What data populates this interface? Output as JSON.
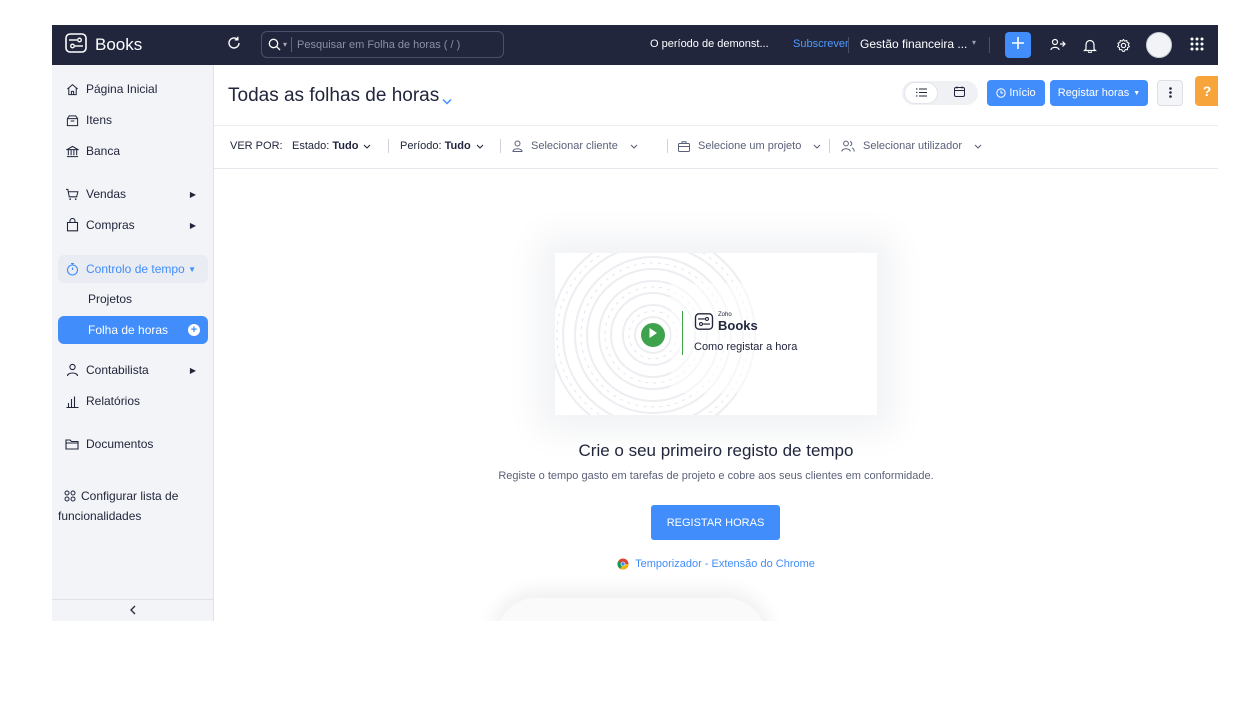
{
  "topbar": {
    "app_name": "Books",
    "search_placeholder": "Pesquisar em Folha de horas ( / )",
    "trial_text": "O período de demonst...",
    "subscribe_label": "Subscrever",
    "organization": "Gestão financeira ...",
    "icons": [
      "recent-activity-icon",
      "search-icon",
      "plus-icon",
      "referral-icon",
      "bell-icon",
      "gear-icon",
      "avatar",
      "apps-grid-icon"
    ]
  },
  "sidebar": {
    "items": [
      {
        "label": "Página Inicial",
        "icon": "home-icon"
      },
      {
        "label": "Itens",
        "icon": "items-icon"
      },
      {
        "label": "Banca",
        "icon": "bank-icon"
      },
      {
        "label": "Vendas",
        "icon": "cart-icon"
      },
      {
        "label": "Compras",
        "icon": "bag-icon"
      },
      {
        "label": "Controlo de tempo",
        "icon": "stopwatch-icon"
      },
      {
        "label": "Contabilista",
        "icon": "accountant-icon"
      },
      {
        "label": "Relatórios",
        "icon": "reports-icon"
      },
      {
        "label": "Documentos",
        "icon": "folder-icon"
      }
    ],
    "sub_items": [
      {
        "label": "Projetos"
      },
      {
        "label": "Folha de horas"
      }
    ],
    "configure_label": "Configurar lista de funcionalidades",
    "collapse_icon": "chevron-left-icon"
  },
  "header": {
    "title": "Todas as folhas de horas",
    "inicio_label": "Início",
    "registar_label": "Registar horas",
    "help_label": "?"
  },
  "filters": {
    "ver_por": "VER POR:",
    "estado_label": "Estado:",
    "estado_value": "Tudo",
    "periodo_label": "Período:",
    "periodo_value": "Tudo",
    "cliente_placeholder": "Selecionar cliente",
    "projeto_placeholder": "Selecione um projeto",
    "utilizador_placeholder": "Selecionar utilizador"
  },
  "empty_state": {
    "video_brand_small": "Zoho",
    "video_brand": "Books",
    "video_caption": "Como registar a hora",
    "title": "Crie o seu primeiro registo de tempo",
    "description": "Registe o tempo gasto em tarefas de projeto e cobre aos seus clientes em conformidade.",
    "cta_label": "REGISTAR HORAS",
    "chrome_link": "Temporizador - Extensão do Chrome"
  },
  "colors": {
    "topbar_bg": "#21263c",
    "accent": "#408dfb",
    "help": "#f7a43b",
    "play": "#3fa34d"
  }
}
